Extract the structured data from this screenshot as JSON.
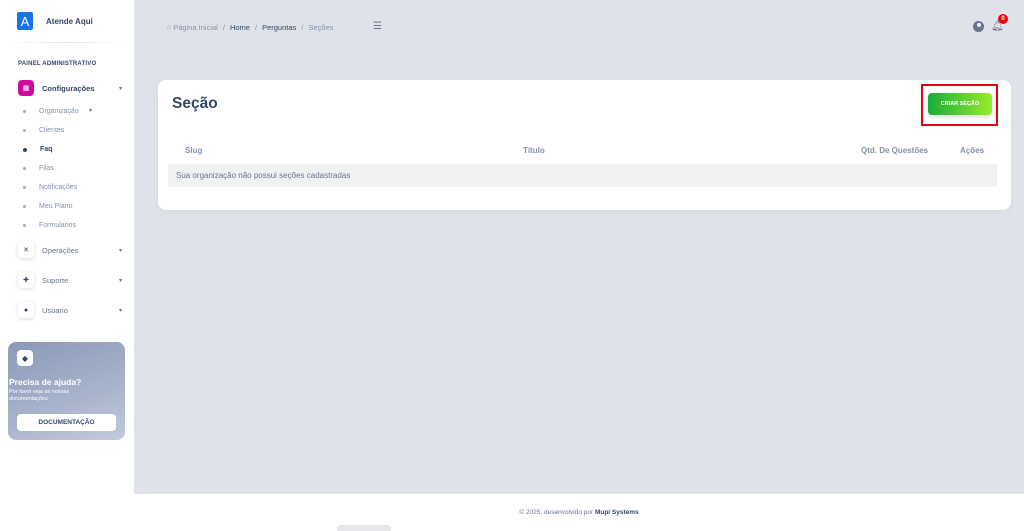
{
  "brand": {
    "logo_letter": "A",
    "name": "Atende Aqui"
  },
  "sidebar": {
    "section_label": "PAINEL ADMINISTRATIVO",
    "config": {
      "label": "Configurações",
      "icon": "gear-icon"
    },
    "sub_items": [
      {
        "label": "Organização"
      },
      {
        "label": "Clientes"
      },
      {
        "label": "Faq"
      },
      {
        "label": "Filas"
      },
      {
        "label": "Notificações"
      },
      {
        "label": "Meu Plano"
      },
      {
        "label": "Formularios"
      }
    ],
    "groups": [
      {
        "label": "Operações"
      },
      {
        "label": "Suporte"
      },
      {
        "label": "Usuario"
      }
    ]
  },
  "help": {
    "title": "Precisa de ajuda?",
    "subtitle": "Por favor veja as nossas documentações",
    "button": "DOCUMENTAÇÃO"
  },
  "breadcrumb": {
    "home": "Página Inicial",
    "items": [
      "Home",
      "Perguntas",
      "Seções"
    ]
  },
  "notifications": {
    "count": "0"
  },
  "card": {
    "title": "Seção",
    "create_button": "CRIAR SEÇÃO",
    "columns": [
      "Slug",
      "Título",
      "Qtd. De Questões",
      "Ações"
    ],
    "empty_message": "Sua organização não possui seções cadastradas"
  },
  "footer": {
    "text": "© 2025, desenvolvido por ",
    "company": "Mupi Systems"
  },
  "colors": {
    "accent": "#cb0c9f",
    "create_button": "#82d616",
    "highlight": "#e3000f",
    "badge": "#ea0606"
  }
}
